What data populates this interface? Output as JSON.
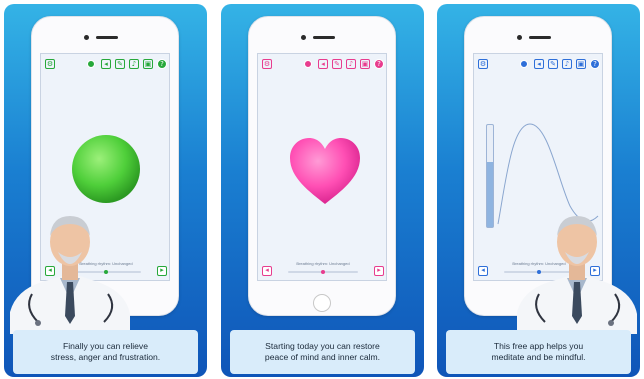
{
  "screens": [
    {
      "caption": [
        "Finally you can relieve",
        "stress, anger and frustration."
      ],
      "status": "Breathing rhythm: Unchanged",
      "accent": "#27a83a",
      "shape": "ball",
      "toolbar_icons": [
        "gear-icon",
        "record-icon",
        "speaker-icon",
        "wrench-icon",
        "music-icon",
        "cart-icon",
        "help-icon"
      ]
    },
    {
      "caption": [
        "Starting today you can restore",
        "peace of mind and inner calm."
      ],
      "status": "Breathing rhythm: Unchanged",
      "accent": "#e83c8e",
      "shape": "heart",
      "toolbar_icons": [
        "gear-icon",
        "record-icon",
        "speaker-icon",
        "wrench-icon",
        "music-icon",
        "cart-icon",
        "help-icon"
      ]
    },
    {
      "caption": [
        "This free app helps you",
        "meditate and be mindful."
      ],
      "status": "Breathing rhythm: Unchanged",
      "accent": "#2e6fd9",
      "shape": "wave",
      "toolbar_icons": [
        "gear-icon",
        "record-icon",
        "speaker-icon",
        "wrench-icon",
        "music-icon",
        "cart-icon",
        "help-icon"
      ]
    }
  ]
}
